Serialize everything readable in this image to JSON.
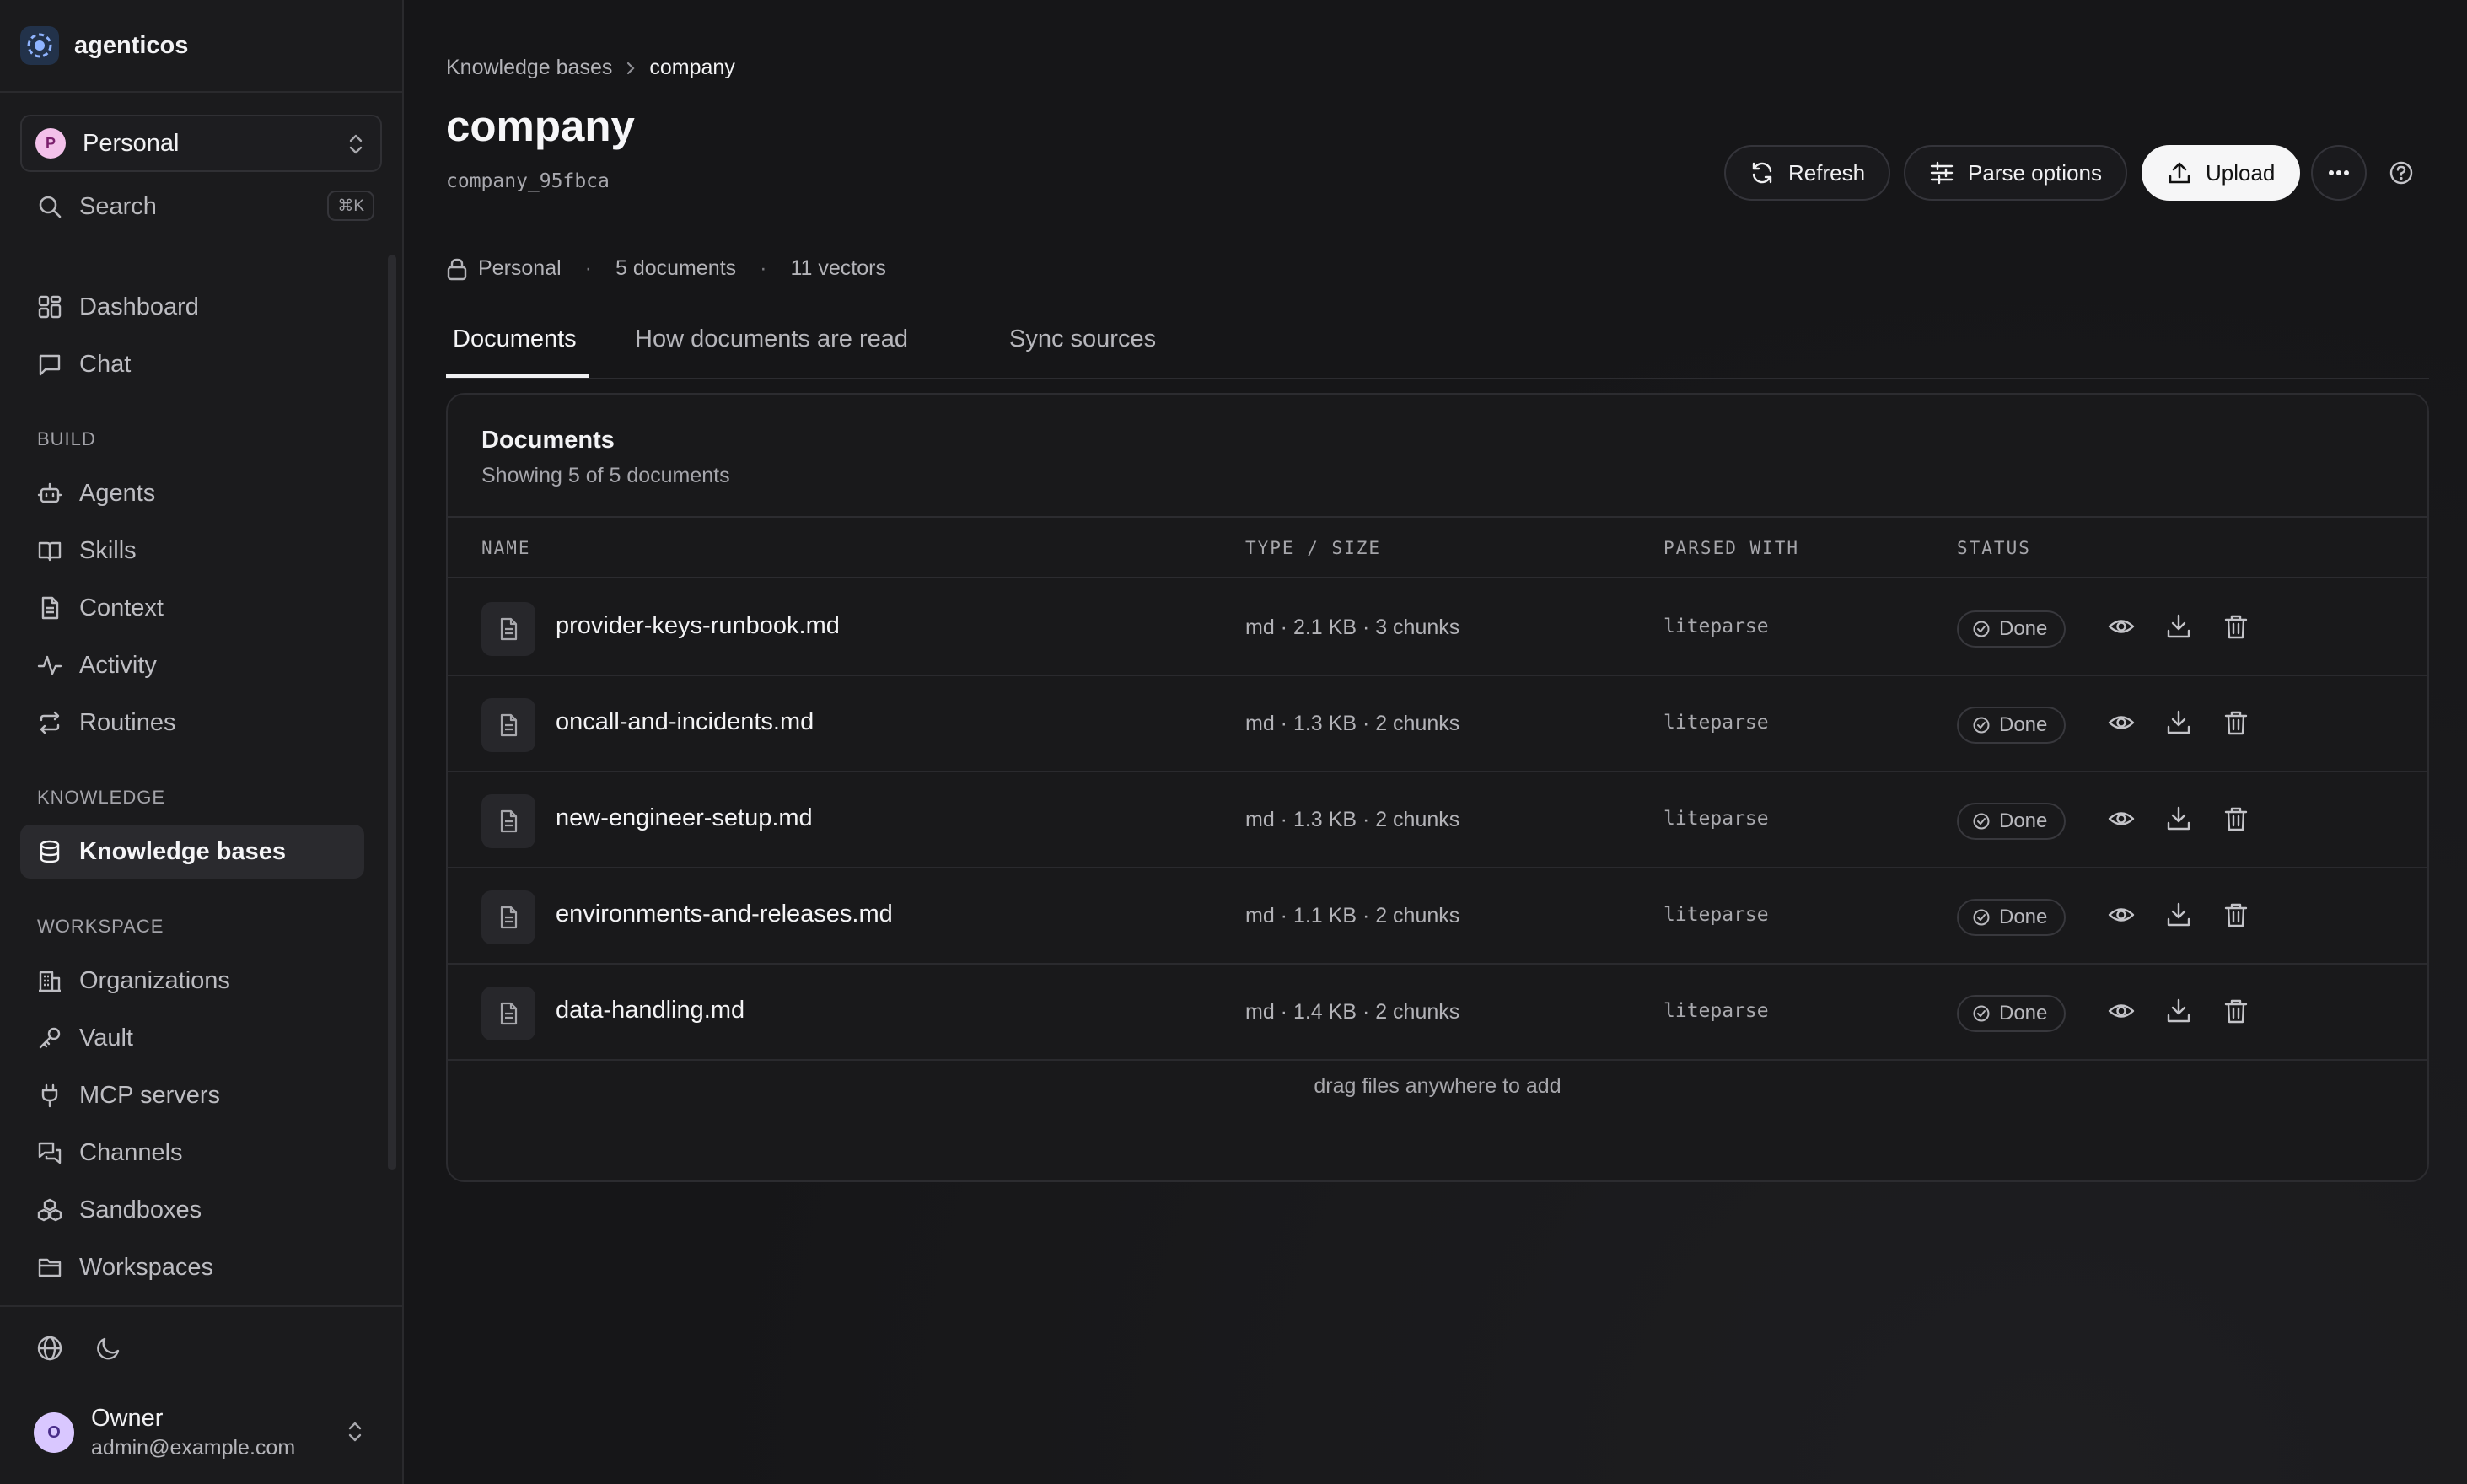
{
  "app": {
    "name": "agenticos"
  },
  "workspace": {
    "label": "Personal",
    "initial": "P"
  },
  "search": {
    "label": "Search",
    "shortcut": "⌘K"
  },
  "sidebar": {
    "top_items": [
      {
        "label": "Dashboard",
        "icon": "dashboard-icon"
      },
      {
        "label": "Chat",
        "icon": "chat-icon"
      }
    ],
    "build": {
      "title": "BUILD",
      "items": [
        {
          "label": "Agents",
          "icon": "bot-icon"
        },
        {
          "label": "Skills",
          "icon": "book-icon"
        },
        {
          "label": "Context",
          "icon": "file-text-icon"
        },
        {
          "label": "Activity",
          "icon": "activity-icon"
        },
        {
          "label": "Routines",
          "icon": "repeat-icon"
        }
      ]
    },
    "knowledge": {
      "title": "KNOWLEDGE",
      "items": [
        {
          "label": "Knowledge bases",
          "icon": "database-icon",
          "active": true
        }
      ]
    },
    "workspace": {
      "title": "WORKSPACE",
      "items": [
        {
          "label": "Organizations",
          "icon": "building-icon"
        },
        {
          "label": "Vault",
          "icon": "key-icon"
        },
        {
          "label": "MCP servers",
          "icon": "plug-icon"
        },
        {
          "label": "Channels",
          "icon": "messages-icon"
        },
        {
          "label": "Sandboxes",
          "icon": "boxes-icon"
        },
        {
          "label": "Workspaces",
          "icon": "folder-icon"
        }
      ]
    }
  },
  "user": {
    "name": "Owner",
    "email": "admin@example.com",
    "initial": "O"
  },
  "breadcrumb": {
    "parent": "Knowledge bases",
    "current": "company"
  },
  "page": {
    "title": "company",
    "slug": "company_95fbca"
  },
  "actions": {
    "refresh": "Refresh",
    "parse_options": "Parse options",
    "upload": "Upload"
  },
  "meta": {
    "visibility": "Personal",
    "documents": "5 documents",
    "vectors": "11 vectors"
  },
  "tabs": [
    "Documents",
    "How documents are read",
    "Sync sources"
  ],
  "documents": {
    "title": "Documents",
    "subtitle": "Showing 5 of 5 documents",
    "columns": [
      "NAME",
      "TYPE / SIZE",
      "PARSED WITH",
      "STATUS"
    ],
    "rows": [
      {
        "name": "provider-keys-runbook.md",
        "type_size": "md · 2.1 KB · 3 chunks",
        "parser": "liteparse",
        "status": "Done"
      },
      {
        "name": "oncall-and-incidents.md",
        "type_size": "md · 1.3 KB · 2 chunks",
        "parser": "liteparse",
        "status": "Done"
      },
      {
        "name": "new-engineer-setup.md",
        "type_size": "md · 1.3 KB · 2 chunks",
        "parser": "liteparse",
        "status": "Done"
      },
      {
        "name": "environments-and-releases.md",
        "type_size": "md · 1.1 KB · 2 chunks",
        "parser": "liteparse",
        "status": "Done"
      },
      {
        "name": "data-handling.md",
        "type_size": "md · 1.4 KB · 2 chunks",
        "parser": "liteparse",
        "status": "Done"
      }
    ],
    "footer": "drag files anywhere to add"
  }
}
